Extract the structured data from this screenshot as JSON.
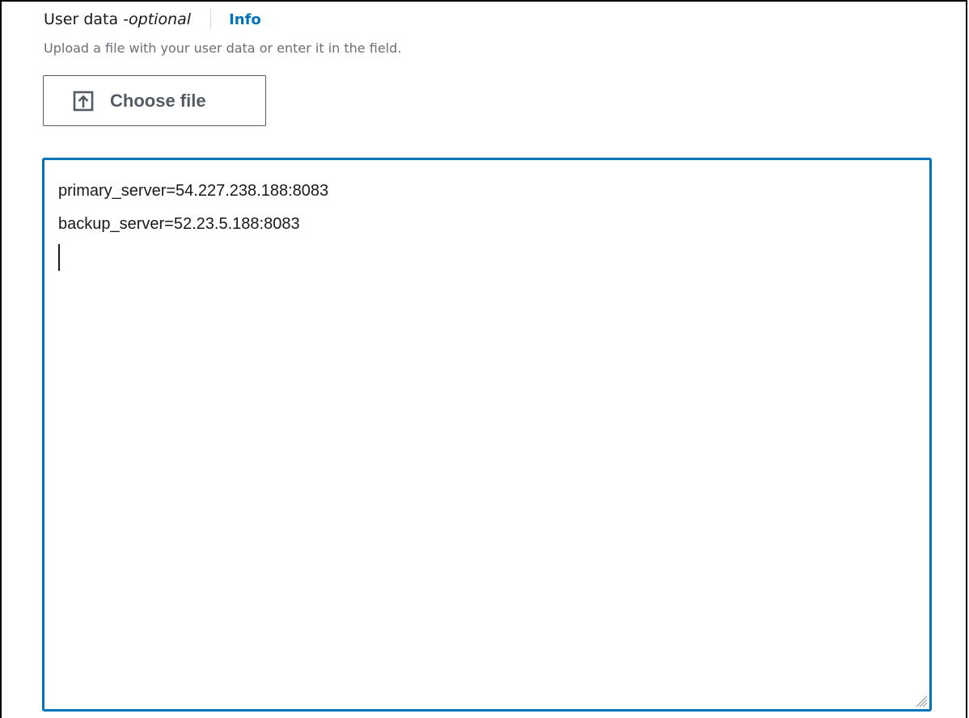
{
  "field": {
    "label": "User data - ",
    "optional_label": "optional",
    "info_link": "Info",
    "description": "Upload a file with your user data or enter it in the field."
  },
  "upload": {
    "icon": "upload-icon",
    "button_label": "Choose file"
  },
  "user_data": {
    "lines": [
      "primary_server=54.227.238.188:8083",
      "backup_server=52.23.5.188:8083"
    ]
  },
  "colors": {
    "accent": "#0073bb",
    "text": "#16191f",
    "muted": "#687078",
    "button_border": "#545b64"
  }
}
